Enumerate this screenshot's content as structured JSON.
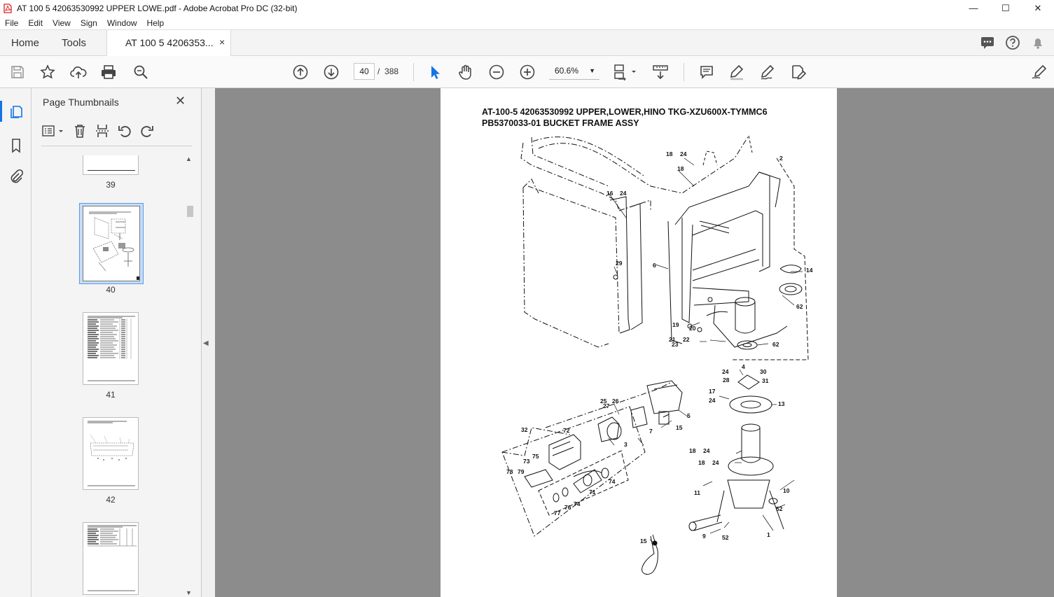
{
  "window": {
    "title": "AT 100 5 42063530992 UPPER LOWE.pdf - Adobe Acrobat Pro DC (32-bit)",
    "controls": [
      "—",
      "☐",
      "✕"
    ]
  },
  "menu": [
    "File",
    "Edit",
    "View",
    "Sign",
    "Window",
    "Help"
  ],
  "tabs": {
    "home": "Home",
    "tools": "Tools",
    "document": "AT 100 5 4206353...",
    "close": "×"
  },
  "toolbar": {
    "current_page": "40",
    "page_separator": "/",
    "total_pages": "388",
    "zoom": "60.6%"
  },
  "thumbnails": {
    "title": "Page Thumbnails",
    "pages": [
      "39",
      "40",
      "41",
      "42",
      ""
    ],
    "selected_page": "40"
  },
  "document": {
    "title_line1": "AT-100-5 42063530992 UPPER,LOWER,HINO TKG-XZU600X-TYMMC6",
    "title_line2": "PB5370033-01 BUCKET FRAME ASSY",
    "callouts": [
      "18",
      "24",
      "18",
      "2",
      "16",
      "24",
      "6",
      "29",
      "14",
      "62",
      "19",
      "20",
      "21",
      "22",
      "23",
      "62",
      "24",
      "4",
      "30",
      "28",
      "31",
      "17",
      "24",
      "13",
      "25",
      "26",
      "27",
      "5",
      "15",
      "7",
      "3",
      "32",
      "72",
      "75",
      "73",
      "78",
      "79",
      "74",
      "71",
      "74",
      "76",
      "77",
      "18",
      "24",
      "18",
      "24",
      "11",
      "10",
      "52",
      "52",
      "9",
      "1",
      "15"
    ]
  },
  "colors": {
    "accent": "#1473e6",
    "viewport_bg": "#8c8c8c"
  }
}
